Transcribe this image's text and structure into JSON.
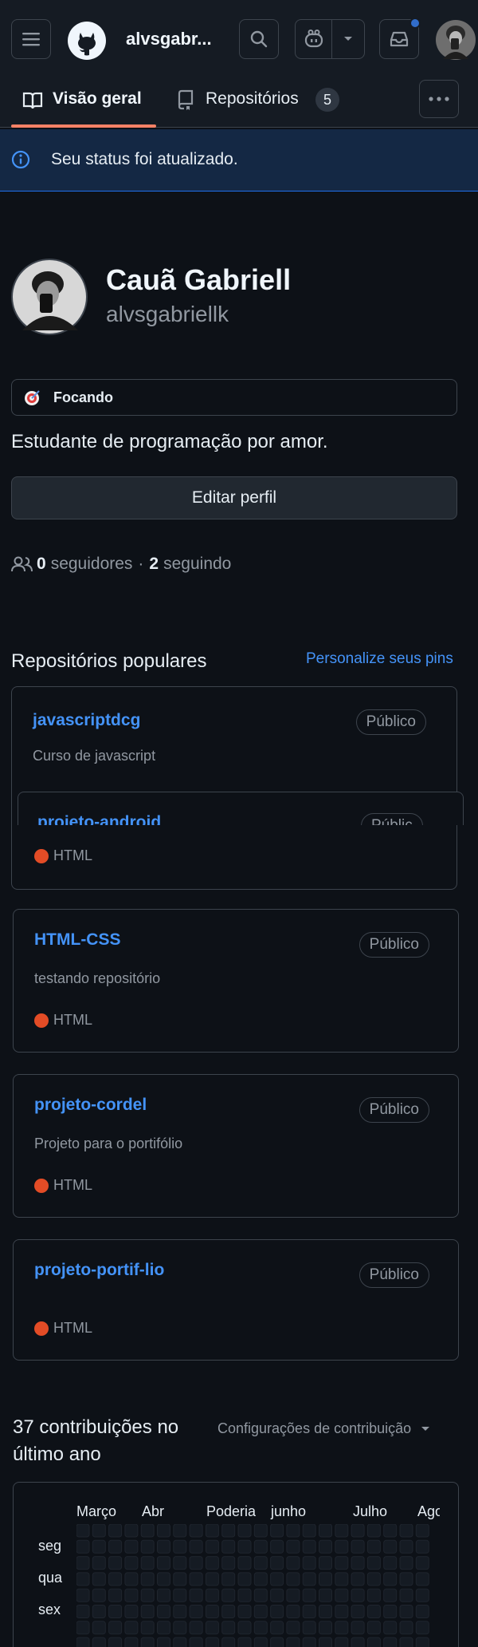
{
  "header": {
    "username": "alvsgabr...",
    "icons": [
      "menu-icon",
      "github-logo-icon",
      "search-icon",
      "copilot-icon",
      "chevron-down-icon",
      "inbox-icon",
      "avatar"
    ]
  },
  "tabs": {
    "overview": "Visão geral",
    "repositories": "Repositórios",
    "repo_count": "5"
  },
  "flash": {
    "text": "Seu status foi atualizado."
  },
  "profile": {
    "name": "Cauã Gabriell",
    "login": "alvsgabriellk",
    "status": "Focando",
    "bio": "Estudante de programação por amor.",
    "edit_label": "Editar perfil",
    "followers_count": "0",
    "followers_label": "seguidores",
    "separator": "·",
    "following_count": "2",
    "following_label": "seguindo"
  },
  "popular": {
    "title": "Repositórios populares",
    "customize": "Personalize seus pins",
    "repos": [
      {
        "name": "javascriptdcg",
        "visibility": "Público",
        "description": "Curso de javascript",
        "language": ""
      },
      {
        "name": "projeto-android",
        "visibility": "Públic",
        "description": "",
        "language": "HTML"
      },
      {
        "name": "HTML-CSS",
        "visibility": "Público",
        "description": "testando repositório",
        "language": "HTML"
      },
      {
        "name": "projeto-cordel",
        "visibility": "Público",
        "description": "Projeto para o portifólio",
        "language": "HTML"
      },
      {
        "name": "projeto-portif-lio",
        "visibility": "Público",
        "description": "",
        "language": "HTML"
      }
    ],
    "lang_color": "#e34c26"
  },
  "contributions": {
    "title": "37 contribuições no último ano",
    "settings": "Configurações de contribuição",
    "months": [
      "Março",
      "Abr",
      "Poderia",
      "junho",
      "Julho",
      "Ago"
    ],
    "days": [
      "seg",
      "qua",
      "sex"
    ]
  },
  "colors": {
    "accent": "#4493f8",
    "tab_underline": "#f78166",
    "notification": "#316dca"
  }
}
